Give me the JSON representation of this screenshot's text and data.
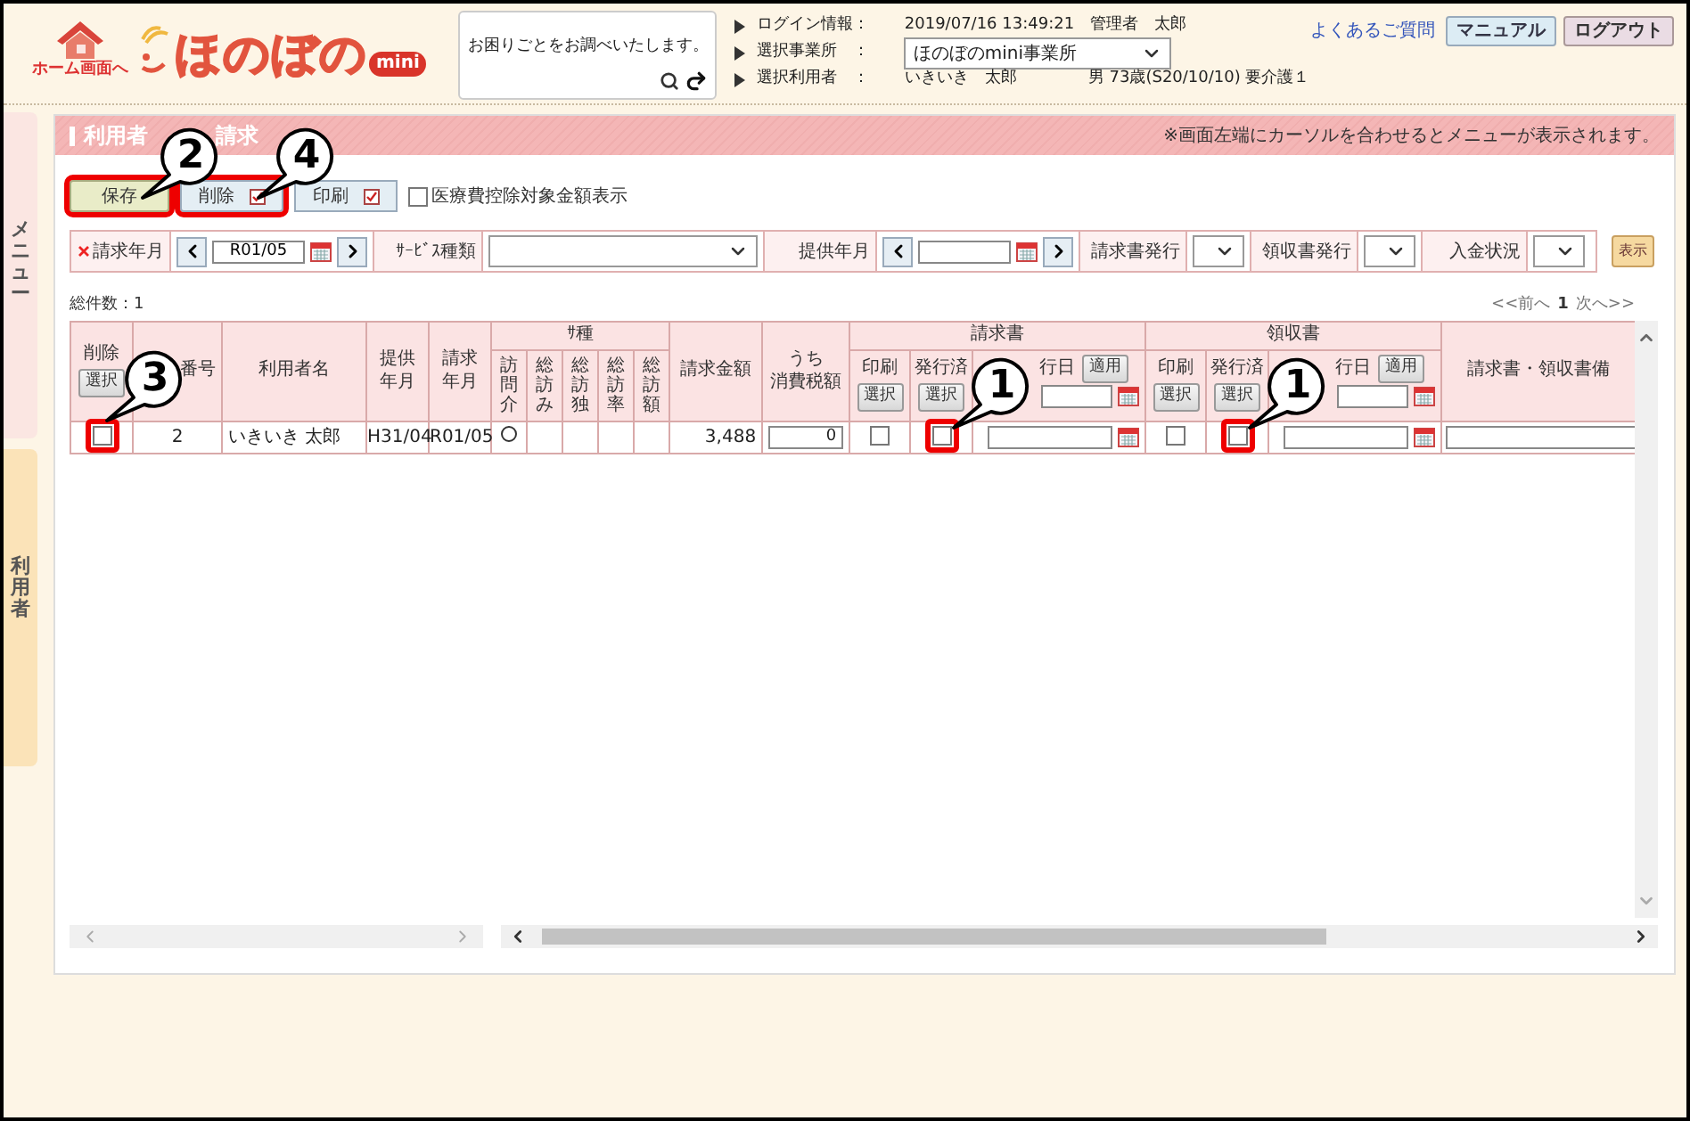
{
  "header": {
    "home_label": "ホーム画面へ",
    "logo": "ほのぼの",
    "logo_badge": "mini",
    "search": {
      "value": "お困りごとをお調べいたします。"
    },
    "info": [
      {
        "label": "ログイン情報：",
        "value": "2019/07/16 13:49:21　管理者　太郎"
      },
      {
        "label": "選択事業所　：",
        "select": "ほのぼのmini事業所"
      },
      {
        "label": "選択利用者　：",
        "value": "いきいき　太郎",
        "extra": "男 73歳(S20/10/10) 要介護１"
      }
    ],
    "links": [
      {
        "kind": "link",
        "label": "よくあるご質問"
      },
      {
        "kind": "button",
        "label": "マニュアル"
      },
      {
        "kind": "button",
        "label": "ログアウト"
      }
    ]
  },
  "side_tabs": [
    {
      "label": "メニュー"
    },
    {
      "label": "利用者"
    }
  ],
  "panel": {
    "title_parts": [
      "利用者",
      "請求"
    ],
    "hint": "※画面左端にカーソルを合わせるとメニューが表示されます。"
  },
  "toolbar": {
    "buttons": [
      {
        "label": "保存",
        "kind": "plain",
        "highlighted": true
      },
      {
        "label": "削除",
        "kind": "checkbox",
        "checked": true,
        "highlighted": true
      },
      {
        "label": "印刷",
        "kind": "checkbox",
        "checked": true,
        "highlighted": false
      }
    ],
    "option": {
      "label": "医療費控除対象金額表示",
      "checked": false
    }
  },
  "filters": [
    {
      "kind": "month",
      "label": "請求年月",
      "required": true,
      "value": "R01/05"
    },
    {
      "kind": "select",
      "label": "ｻｰﾋﾞｽ種類",
      "required": false,
      "wide": true
    },
    {
      "kind": "month",
      "label": "提供年月",
      "required": false
    },
    {
      "kind": "select",
      "label": "請求書発行",
      "required": false,
      "wide": false
    },
    {
      "kind": "select",
      "label": "領収書発行",
      "required": false,
      "wide": false
    },
    {
      "kind": "select",
      "label": "入金状況",
      "required": false,
      "wide": false
    }
  ],
  "show_button": "表示",
  "total": "総件数：1",
  "pagination": [
    "<<前へ",
    "1",
    "次へ>>"
  ],
  "table": {
    "columns": [
      {
        "label": "削除",
        "button": "選択"
      },
      {
        "label": "番号"
      },
      {
        "label": "利用者名"
      },
      {
        "lines": [
          "提供",
          "年月"
        ]
      },
      {
        "lines": [
          "請求",
          "年月"
        ]
      },
      {
        "label": "ｻ種",
        "children": [
          {
            "label": "訪問介"
          },
          {
            "label": "総訪み"
          },
          {
            "label": "総訪独"
          },
          {
            "label": "総訪率"
          },
          {
            "label": "総訪額"
          }
        ]
      },
      {
        "label": "請求金額"
      },
      {
        "lines": [
          "うち",
          "消費税額"
        ]
      },
      {
        "label": "請求書",
        "children": [
          {
            "label": "印刷",
            "button": "選択"
          },
          {
            "label": "発行済",
            "button": "選択"
          },
          {
            "label": "行日",
            "button": "適用"
          }
        ]
      },
      {
        "label": "領収書",
        "children": [
          {
            "label": "印刷",
            "button": "選択"
          },
          {
            "label": "発行済",
            "button": "選択"
          },
          {
            "label": "行日",
            "button": "適用"
          }
        ]
      },
      {
        "label": "請求書・領収書備"
      }
    ],
    "rows": [
      {
        "delete": {
          "checked": false,
          "highlighted": true
        },
        "number": "2",
        "name": "いきいき 太郎",
        "provided": "H31/04",
        "billed": "R01/05",
        "services": [
          {
            "on": true
          },
          {
            "on": false
          },
          {
            "on": false
          },
          {
            "on": false
          },
          {
            "on": false
          }
        ],
        "amount": "3,488",
        "tax": "0",
        "invoice": {
          "print": false,
          "issued": false,
          "issued_highlighted": true
        },
        "receipt": {
          "print": false,
          "issued": false,
          "issued_highlighted": true
        }
      }
    ]
  },
  "callouts": [
    {
      "number": "2"
    },
    {
      "number": "4"
    },
    {
      "number": "3"
    },
    {
      "number": "1"
    },
    {
      "number": "1"
    }
  ]
}
